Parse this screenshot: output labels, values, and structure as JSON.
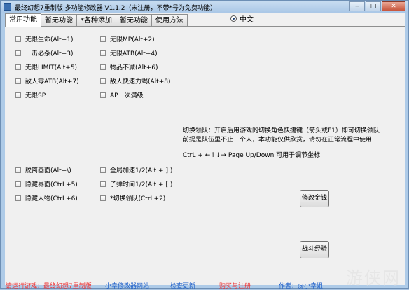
{
  "window": {
    "title": "最终幻想7重制版 多功能修改器  V1.1.2（未注册，不带*号为免费功能）"
  },
  "tabs": [
    "常用功能",
    "暂无功能",
    "*各种添加",
    "暂无功能",
    "使用方法"
  ],
  "language": {
    "label": "中文"
  },
  "group1": [
    "无限生命(Alt+1)",
    "一击必杀(Alt+3)",
    "无限LIMIT(Alt+5)",
    "敌人零ATB(Alt+7)",
    "无限SP"
  ],
  "group2": [
    "无限MP(Alt+2)",
    "无限ATB(Alt+4)",
    "物品不减(Alt+6)",
    "敌人快速力竭(Alt+8)",
    "AP一次满级"
  ],
  "group3": [
    "脱离画面(Alt+\\)",
    "隐藏界面(CtrL+5)",
    "隐藏人物(CtrL+6)"
  ],
  "group4": [
    "全局加速1/2(Alt + ] )",
    "子弹时间1/2(Alt + [ )",
    "*切换领队(CtrL+2)"
  ],
  "info": {
    "line1": "切换领队：开启后用游戏的切换角色快捷键（箭头或F1）即可切换领队",
    "line2": "前提是队伍里不止一个人，本功能仅供欣赏，请勿在正常流程中使用",
    "line3": "CtrL + ←↑↓→  Page Up/Down 可用于调节坐标"
  },
  "buttons": {
    "money": "修改金钱",
    "battle": "战斗经验"
  },
  "footer": {
    "status": "请运行游戏：最终幻想7重制版",
    "website": "小幸修改器网站",
    "update": "检查更新",
    "register": "购买与注册",
    "author": "作者：@小幸姐"
  },
  "watermark": "游侠网"
}
